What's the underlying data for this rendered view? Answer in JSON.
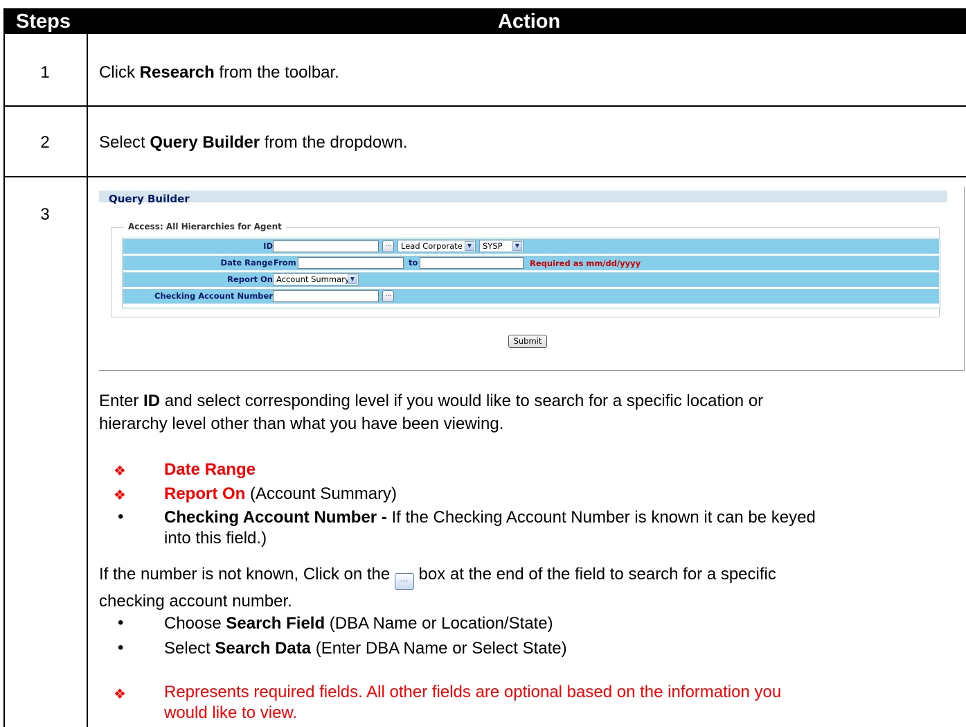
{
  "table": {
    "header_steps": "Steps",
    "header_action": "Action"
  },
  "steps": [
    {
      "num": "1",
      "pre": "Click ",
      "bold": "Research",
      "post": " from the toolbar."
    },
    {
      "num": "2",
      "pre": "Select ",
      "bold": "Query Builder",
      "post": " from the dropdown."
    },
    {
      "num": "3"
    }
  ],
  "query_builder": {
    "title": "Query Builder",
    "fieldset_legend": "Access: All Hierarchies for Agent",
    "id_label": "ID",
    "id_value": "",
    "lookup_button": "...",
    "level_select": "Lead Corporate",
    "system_select": "SYSP",
    "date_range_label": "Date Range",
    "from_label": "From",
    "from_value": "",
    "to_label": "to",
    "to_value": "",
    "date_hint": "Required as mm/dd/yyyy",
    "report_on_label": "Report On",
    "report_on_select": "Account Summary",
    "checking_label": "Checking Account Number",
    "checking_value": "",
    "submit_label": "Submit"
  },
  "instructions": {
    "intro_pre": "Enter ",
    "intro_bold": "ID",
    "intro_post_line1": " and select corresponding level if you would like to search for a specific location or",
    "intro_line2": "hierarchy level other than what you have been viewing.",
    "req_item1": "Date Range",
    "req_item2_bold": "Report On",
    "req_item2_rest": " (Account Summary)",
    "item3_bold": "Checking Account Number - ",
    "item3_rest_line1": "If the Checking Account Number is known it can be keyed",
    "item3_line2": "into this field.)",
    "unknown_pre": "If the number is not known, Click on the ",
    "unknown_post": " box at the end of the field to search for a specific",
    "unknown_line2": "checking account number.",
    "sub1_pre": "Choose ",
    "sub1_bold": "Search Field",
    "sub1_post": " (DBA Name or Location/State)",
    "sub2_pre": "Select ",
    "sub2_bold": "Search Data",
    "sub2_post": " (Enter DBA Name or Select State)",
    "note_line1": "Represents required fields. All other fields are optional based on the information you",
    "note_line2": "would like to view."
  },
  "colors": {
    "header_bg": "#000000",
    "qb_row_bg": "#87ceeb",
    "required_red": "#ff0000"
  },
  "icons": {
    "required_bullet": "diamond-bullet-icon",
    "lookup": "ellipsis-button-icon"
  }
}
